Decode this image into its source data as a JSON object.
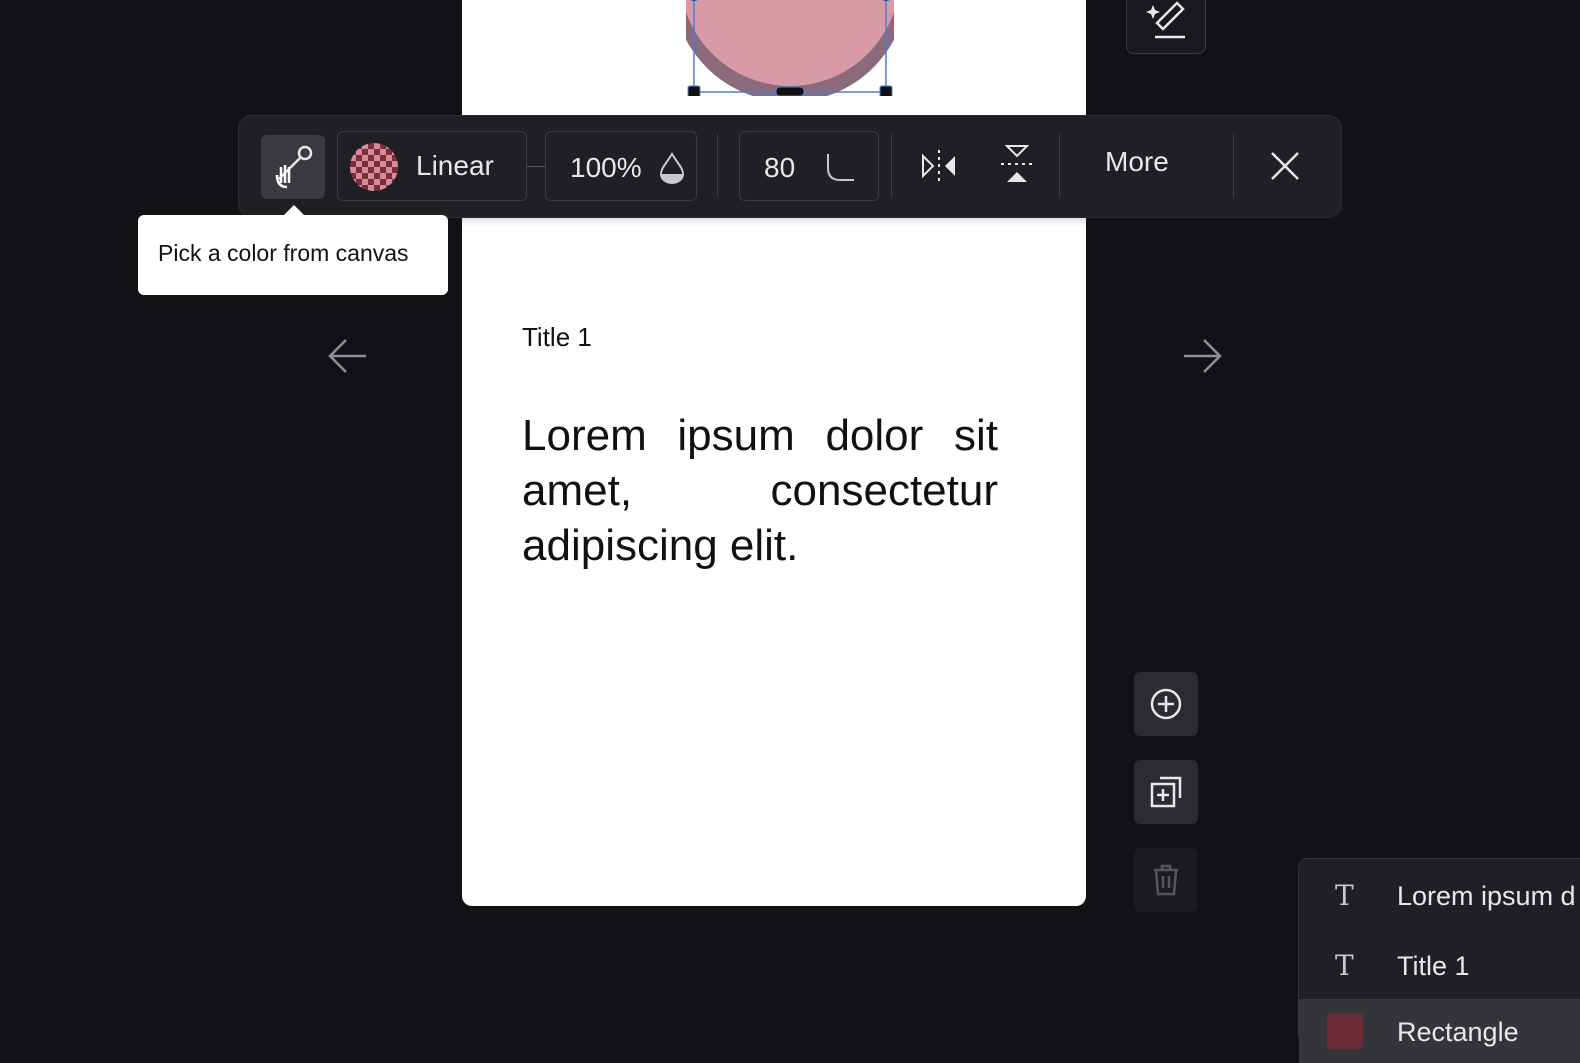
{
  "slide": {
    "title": "Title 1",
    "body": "Lorem ipsum dolor sit amet, consectetur adipiscing elit."
  },
  "toolbar": {
    "fill_type": "Linear",
    "opacity": "100%",
    "corner_radius": "80",
    "more_label": "More"
  },
  "tooltip": {
    "text": "Pick a color from canvas"
  },
  "layers": [
    {
      "type": "text",
      "name": "Lorem ipsum d"
    },
    {
      "type": "text",
      "name": "Title 1"
    },
    {
      "type": "rect",
      "name": "Rectangle"
    }
  ],
  "colors": {
    "background": "#111216",
    "shape_fill": "#d99aa8",
    "shape_shadow": "#8a6a7c",
    "selection": "#4a7fd6",
    "accent_swatch": "#7a2e3c"
  },
  "icons": {
    "eyedropper": "eyedropper-icon",
    "opacity": "droplet-icon",
    "radius": "corner-radius-icon",
    "flip_h": "flip-horizontal-icon",
    "flip_v": "flip-vertical-icon",
    "close": "close-icon",
    "add": "add-slide-icon",
    "duplicate": "duplicate-slide-icon",
    "delete": "delete-icon",
    "magic": "magic-edit-icon",
    "prev": "arrow-left-icon",
    "next": "arrow-right-icon"
  }
}
